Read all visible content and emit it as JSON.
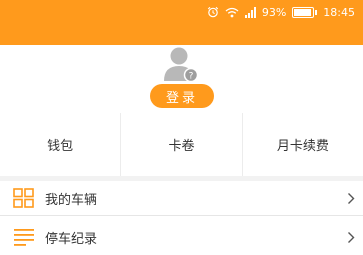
{
  "status_bar": {
    "battery": "93%",
    "battery_level": 0.93,
    "time": "18:45",
    "icons": [
      "alarm-icon",
      "wifi-icon",
      "signal-icon",
      "battery-icon"
    ]
  },
  "profile": {
    "avatar": "avatar-icon",
    "login_label": "登录"
  },
  "quick_links": [
    {
      "label": "钱包"
    },
    {
      "label": "卡卷"
    },
    {
      "label": "月卡续费"
    }
  ],
  "menu": [
    {
      "label": "我的车辆",
      "icon": "grid-icon"
    },
    {
      "label": "停车纪录",
      "icon": "list-icon"
    }
  ],
  "colors": {
    "accent": "#ff9a1c",
    "text": "#333333",
    "divider": "#e6e6e6",
    "avatar_gray": "#b8b8b8"
  }
}
